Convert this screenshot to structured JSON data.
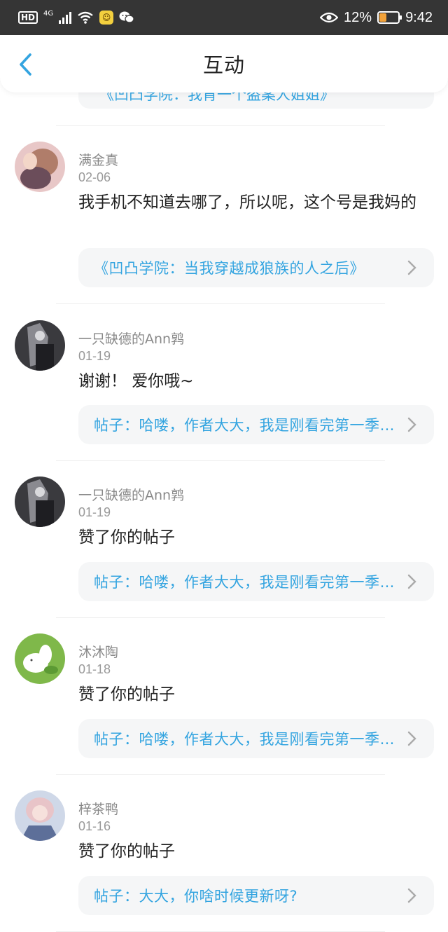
{
  "status_bar": {
    "hd": "HD",
    "network": "4G",
    "battery_percent": "12%",
    "battery_level": 0.12,
    "time": "9:42",
    "icons": [
      "hd-icon",
      "signal-icon",
      "wifi-icon",
      "app-notification-icon",
      "wechat-icon",
      "eye-icon",
      "battery-icon"
    ]
  },
  "header": {
    "title": "互动",
    "back_icon": "chevron-left-icon"
  },
  "partial_top_link": "《凹凸学院：我肯一个盗案人姐姐》",
  "items": [
    {
      "name": "满金真",
      "date": "02-06",
      "message": "我手机不知道去哪了，所以呢，这个号是我妈的",
      "link": "《凹凸学院：当我穿越成狼族的人之后》",
      "avatar_colors": [
        "#e8c7c7",
        "#b07d6a",
        "#6b4d5a"
      ]
    },
    {
      "name": "一只缺德的Ann鹑",
      "date": "01-19",
      "message": "谢谢！ 爱你哦~",
      "link": "帖子：哈喽，作者大大，我是刚看完第一季的读者",
      "avatar_colors": [
        "#3a3a3e",
        "#8a8a90",
        "#1e1e22"
      ]
    },
    {
      "name": "一只缺德的Ann鹑",
      "date": "01-19",
      "message": "赞了你的帖子",
      "link": "帖子：哈喽，作者大大，我是刚看完第一季的读者",
      "avatar_colors": [
        "#3a3a3e",
        "#8a8a90",
        "#1e1e22"
      ]
    },
    {
      "name": "沐沐陶",
      "date": "01-18",
      "message": "赞了你的帖子",
      "link": "帖子：哈喽，作者大大，我是刚看完第一季的读者",
      "avatar_colors": [
        "#7fb84a",
        "#ffffff",
        "#5c9a34"
      ]
    },
    {
      "name": "梓茶鸭",
      "date": "01-16",
      "message": "赞了你的帖子",
      "link": "帖子：大大，你啥时候更新呀?",
      "avatar_colors": [
        "#cfd8e8",
        "#e8c4c8",
        "#5d6f99"
      ]
    }
  ],
  "colors": {
    "accent": "#33a4e0",
    "status_bar": "#353535",
    "card_bg": "#f5f6f7"
  }
}
